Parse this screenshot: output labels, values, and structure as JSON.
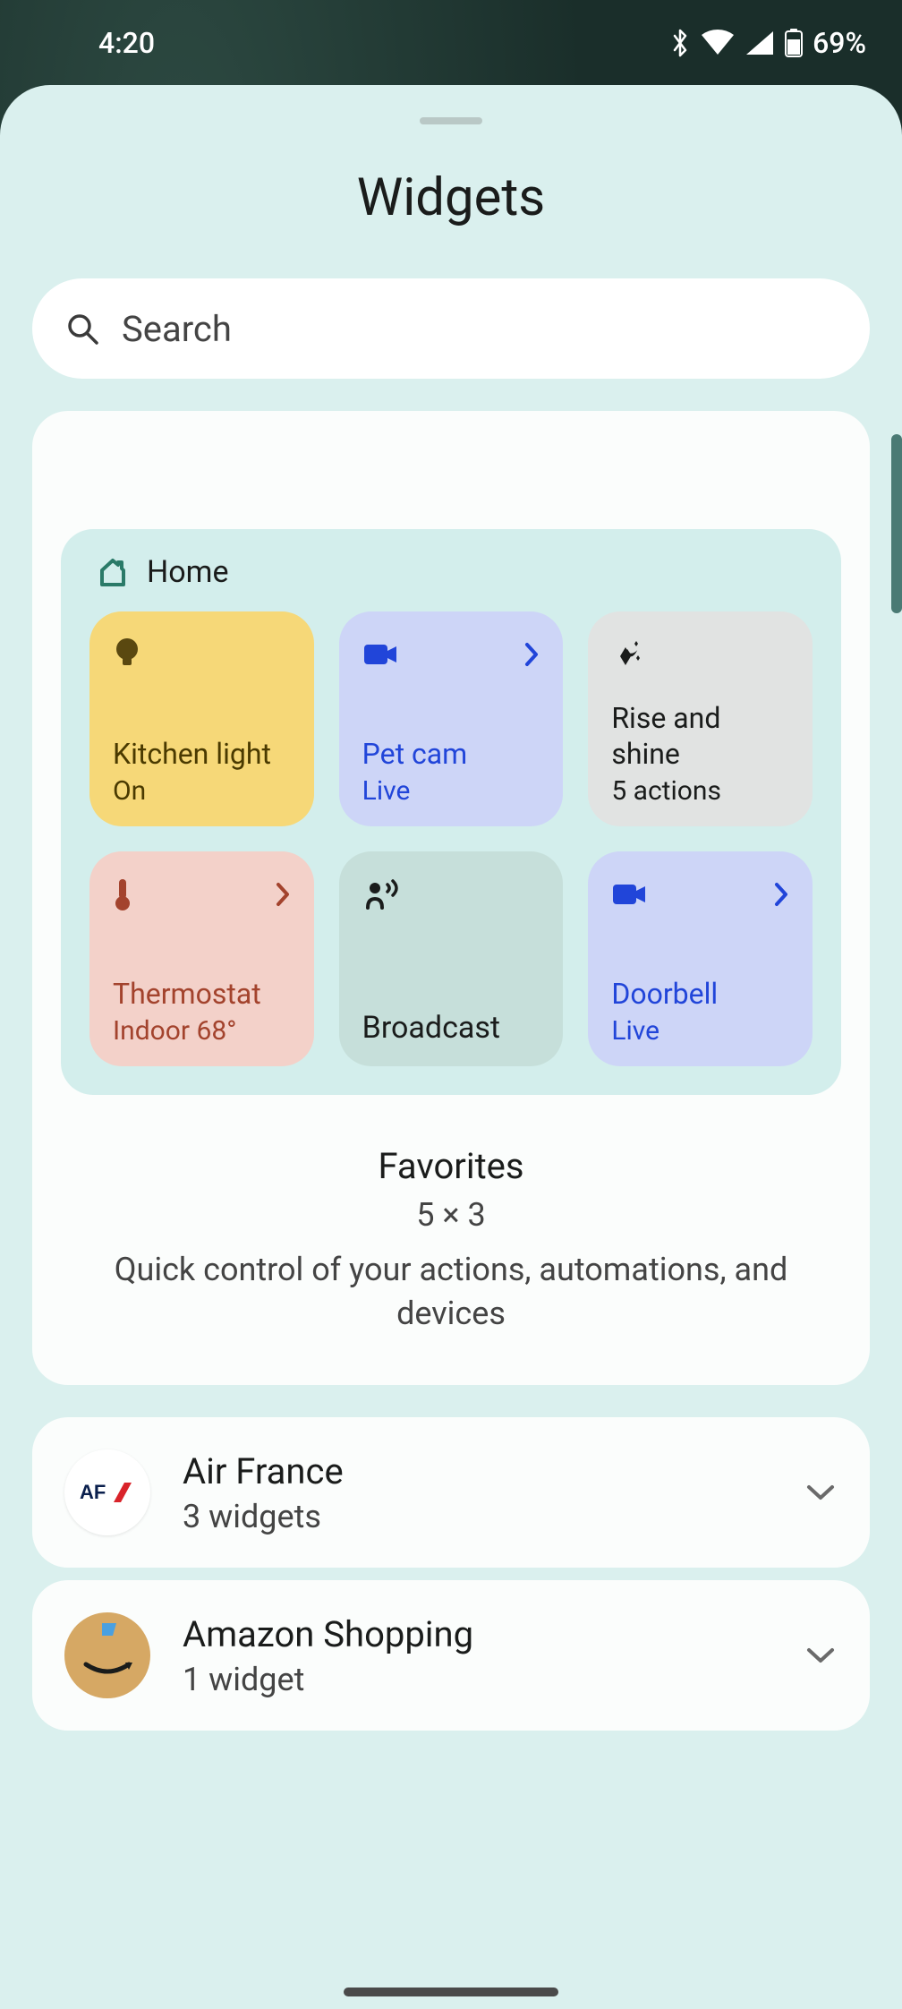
{
  "status": {
    "time": "4:20",
    "battery": "69%"
  },
  "sheet": {
    "title": "Widgets",
    "search_placeholder": "Search"
  },
  "home_widget": {
    "header": "Home",
    "tiles": [
      {
        "title": "Kitchen light",
        "sub": "On"
      },
      {
        "title": "Pet cam",
        "sub": "Live"
      },
      {
        "title": "Rise and shine",
        "sub": "5 actions"
      },
      {
        "title": "Thermostat",
        "sub": "Indoor 68°"
      },
      {
        "title": "Broadcast",
        "sub": ""
      },
      {
        "title": "Doorbell",
        "sub": "Live"
      }
    ],
    "meta": {
      "name": "Favorites",
      "size": "5 × 3",
      "desc": "Quick control of your actions, automations, and devices"
    }
  },
  "apps": [
    {
      "name": "Air France",
      "count": "3 widgets"
    },
    {
      "name": "Amazon Shopping",
      "count": "1 widget"
    }
  ]
}
